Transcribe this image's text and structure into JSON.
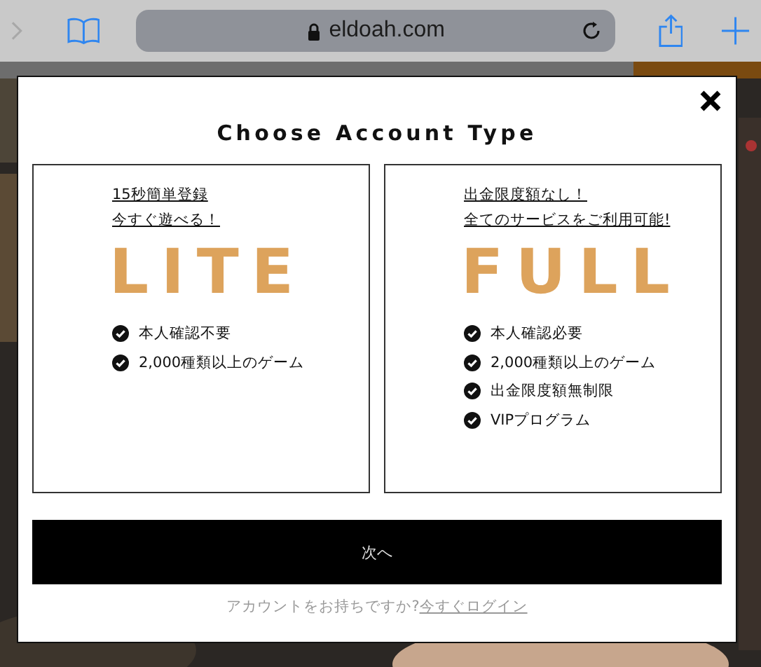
{
  "browser": {
    "url": "eldoah.com"
  },
  "dialog": {
    "title": "Choose Account Type",
    "plans": [
      {
        "taglines": [
          "15秒簡単登録",
          "今すぐ遊べる！"
        ],
        "name": "LITE",
        "features": [
          "本人確認不要",
          "2,000種類以上のゲーム"
        ]
      },
      {
        "taglines": [
          "出金限度額なし！",
          "全てのサービスをご利用可能!"
        ],
        "name": "FULL",
        "features": [
          "本人確認必要",
          "2,000種類以上のゲーム",
          "出金限度額無制限",
          "VIPプログラム"
        ]
      }
    ],
    "next_button": "次へ",
    "login_prompt": {
      "text": "アカウントをお持ちですか?",
      "link": "今すぐログイン"
    }
  }
}
